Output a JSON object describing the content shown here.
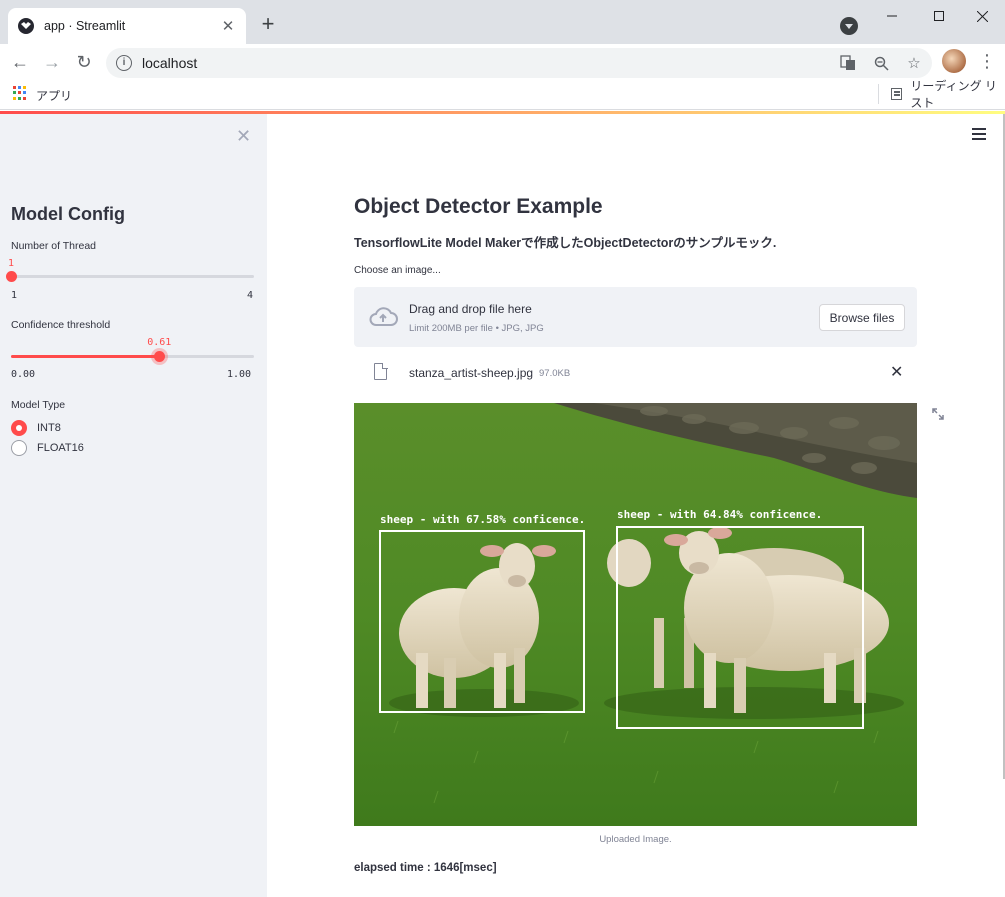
{
  "browser": {
    "tab_title": "app · Streamlit",
    "url": "localhost",
    "bookmarks_apps_label": "アプリ",
    "reading_list_label": "リーディング リスト"
  },
  "sidebar": {
    "title": "Model Config",
    "thread": {
      "label": "Number of Thread",
      "value": 1,
      "value_text": "1",
      "min": "1",
      "max": "4"
    },
    "confidence": {
      "label": "Confidence threshold",
      "value": 0.61,
      "value_text": "0.61",
      "min": "0.00",
      "max": "1.00"
    },
    "model_type": {
      "label": "Model Type",
      "options": [
        "INT8",
        "FLOAT16"
      ],
      "selected": "INT8"
    }
  },
  "main": {
    "title": "Object Detector Example",
    "description": "TensorflowLite Model Makerで作成したObjectDetectorのサンプルモック.",
    "uploader": {
      "label": "Choose an image...",
      "drop_text": "Drag and drop file here",
      "limit_text": "Limit 200MB per file • JPG, JPG",
      "browse_label": "Browse files"
    },
    "file": {
      "name": "stanza_artist-sheep.jpg",
      "size": "97.0KB"
    },
    "detections": [
      {
        "label": "sheep  -  with 67.58% conficence."
      },
      {
        "label": "sheep  -  with 64.84% conficence."
      }
    ],
    "caption": "Uploaded Image.",
    "elapsed": "elapsed time : 1646[msec]"
  },
  "colors": {
    "accent": "#ff4b4b",
    "sidebar_bg": "#f0f2f6",
    "text": "#31333f"
  }
}
